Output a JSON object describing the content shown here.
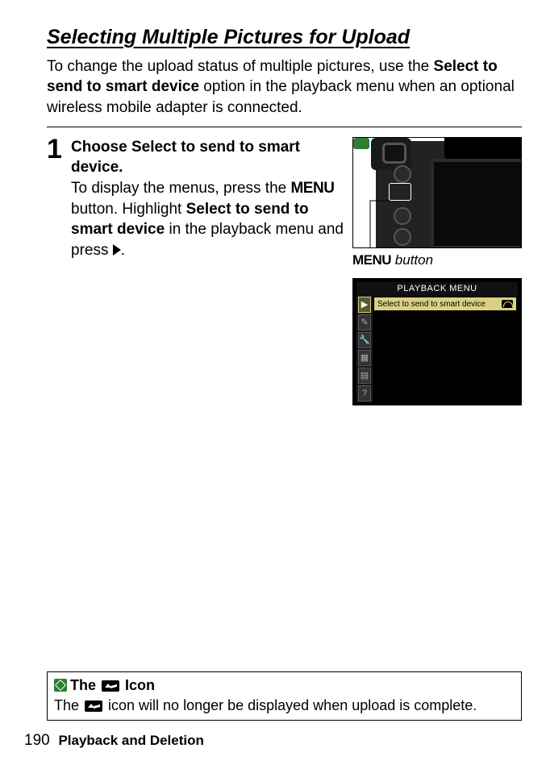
{
  "heading": "Selecting Multiple Pictures for Upload",
  "intro": {
    "pre": "To change the upload status of multiple pictures, use the ",
    "bold": "Select to send to smart device",
    "post": " option in the playback menu when an optional wireless mobile adapter is connected."
  },
  "step": {
    "number": "1",
    "lead_pre": "Choose ",
    "lead_bold": "Select to send to smart device",
    "lead_post": ".",
    "body_pre": "To display the menus, press the ",
    "body_menu": "MENU",
    "body_mid": " button.  Highlight ",
    "body_bold": "Select to send to smart device",
    "body_post": " in the playback menu and press ",
    "body_end": "."
  },
  "fig1": {
    "caption_menu": "MENU",
    "caption_rest": " button"
  },
  "screen": {
    "title": "PLAYBACK MENU",
    "selected": "Select to send to smart device",
    "sidebar_icons": [
      "▶",
      "✎",
      "🔧",
      "▦",
      "▤",
      "?"
    ]
  },
  "note": {
    "title_pre": "The ",
    "title_post": " Icon",
    "body_pre": "The ",
    "body_post": " icon will no longer be displayed when upload is complete."
  },
  "footer": {
    "page": "190",
    "section": "Playback and Deletion"
  }
}
